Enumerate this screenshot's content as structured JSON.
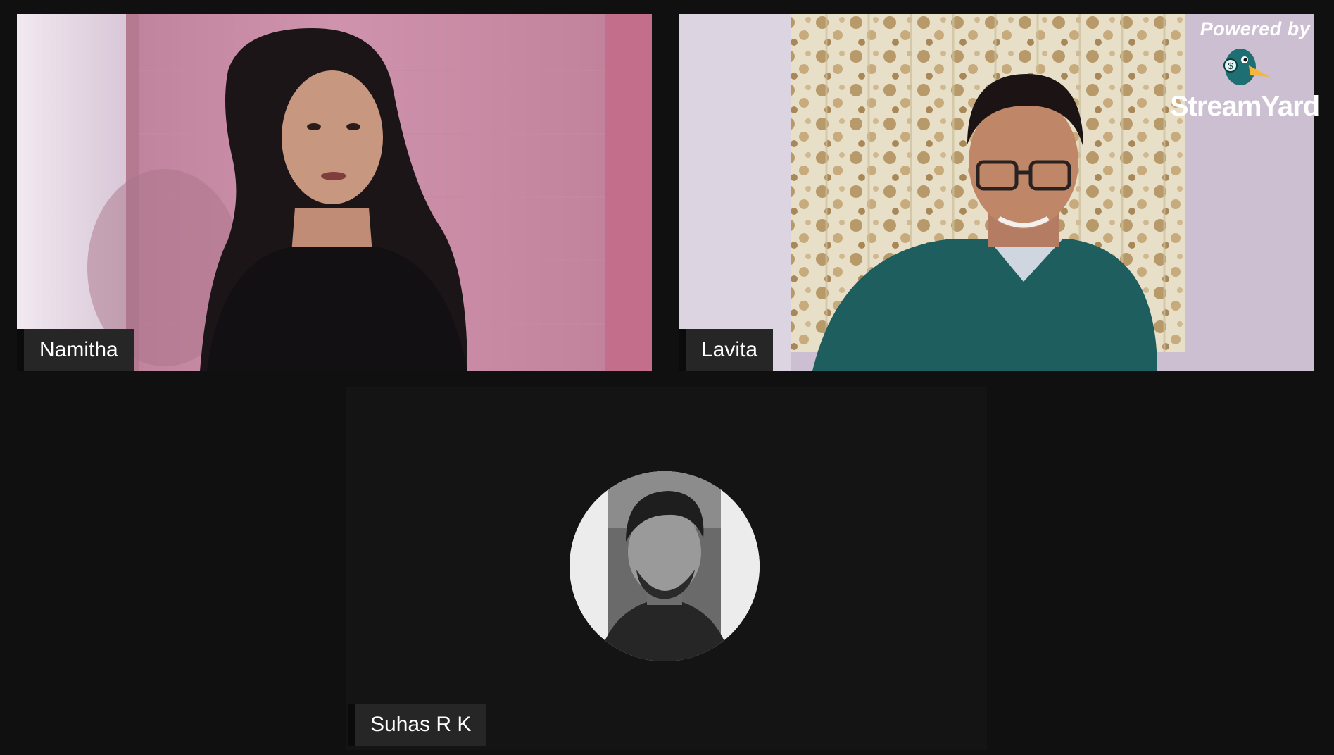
{
  "participants": [
    {
      "name": "Namitha",
      "state": "video"
    },
    {
      "name": "Lavita",
      "state": "video"
    },
    {
      "name": "Suhas R K",
      "state": "avatar"
    }
  ],
  "watermark": {
    "powered_by": "Powered by",
    "brand": "StreamYard",
    "logo_icon": "duck-mascot-icon",
    "logo_badge": "$"
  },
  "colors": {
    "background": "#101010",
    "nametag_bg": "#262626",
    "nametag_text": "#ffffff",
    "wall_pink": "#c88aa0",
    "wall_lilac": "#c8b6c8",
    "shirt_teal": "#1f5e5e",
    "duck_teal": "#1d6f73",
    "duck_beak": "#f4b63c"
  }
}
